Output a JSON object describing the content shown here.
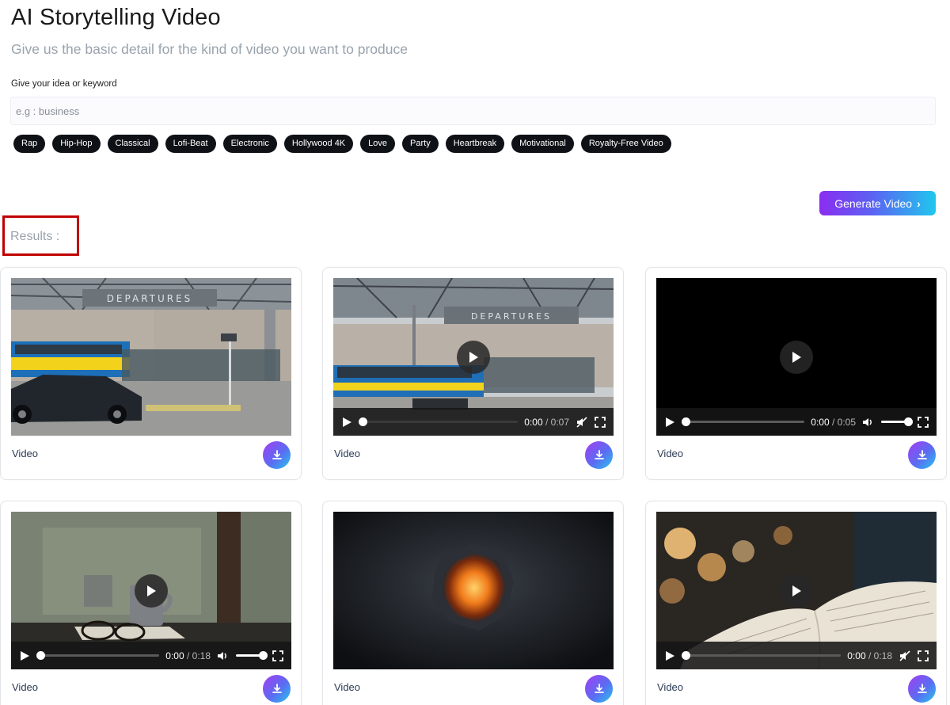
{
  "header": {
    "title": "AI Storytelling Video",
    "subtitle": "Give us the basic detail for the kind of video you want to produce"
  },
  "form": {
    "idea_label": "Give your idea or keyword",
    "idea_placeholder": "e.g : business",
    "idea_value": ""
  },
  "chips": [
    "Rap",
    "Hip-Hop",
    "Classical",
    "Lofi-Beat",
    "Electronic",
    "Hollywood 4K",
    "Love",
    "Party",
    "Heartbreak",
    "Motivational",
    "Royalty-Free Video"
  ],
  "generate_button": {
    "label": "Generate Video"
  },
  "results": {
    "title": "Results :",
    "cards": [
      {
        "label": "Video",
        "scene": "airport-departures",
        "has_controls": false
      },
      {
        "label": "Video",
        "scene": "airport-departures",
        "has_controls": true,
        "current_time": "0:00",
        "duration": "0:07",
        "muted": true
      },
      {
        "label": "Video",
        "scene": "black",
        "has_controls": true,
        "current_time": "0:00",
        "duration": "0:05",
        "muted": false
      },
      {
        "label": "Video",
        "scene": "rainy-window-mug",
        "has_controls": true,
        "current_time": "0:00",
        "duration": "0:18",
        "muted": false
      },
      {
        "label": "Video",
        "scene": "fire-rock",
        "has_controls": false
      },
      {
        "label": "Video",
        "scene": "open-book-bokeh",
        "has_controls": true,
        "current_time": "0:00",
        "duration": "0:18",
        "muted": true
      }
    ]
  },
  "colors": {
    "accent_gradient_start": "#8a2df0",
    "accent_gradient_end": "#20c7ee",
    "highlight_frame": "#c00000",
    "chip_bg": "#0e1116"
  }
}
